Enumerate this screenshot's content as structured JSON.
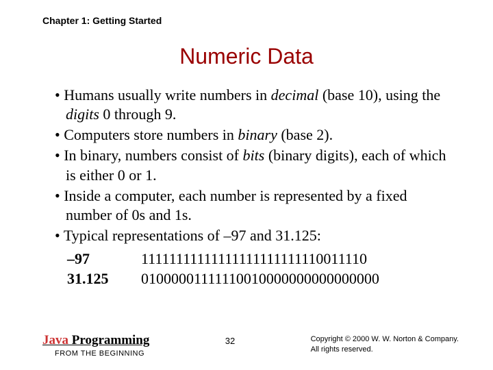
{
  "chapter": "Chapter 1: Getting Started",
  "title": "Numeric Data",
  "bullets": {
    "b0a": "Humans usually write numbers in ",
    "b0i1": "decimal",
    "b0b": " (base 10), using the ",
    "b0i2": "digits",
    "b0c": " 0 through 9.",
    "b1a": "Computers store numbers in ",
    "b1i1": "binary",
    "b1b": " (base 2).",
    "b2a": "In binary, numbers consist of ",
    "b2i1": "bits",
    "b2b": " (binary digits), each of which is either 0 or 1.",
    "b3": "Inside a computer, each number is represented by a fixed number of 0s and 1s.",
    "b4": "Typical representations of –97 and 31.125:"
  },
  "table": {
    "r0": {
      "label": "–97",
      "value": "11111111111111111111111110011110"
    },
    "r1": {
      "label": "31.125",
      "value": "01000001111110010000000000000000"
    }
  },
  "footer": {
    "brand_java": "Java",
    "brand_prog": " Programming",
    "brand_sub": "FROM THE BEGINNING",
    "page": "32",
    "copy1": "Copyright © 2000 W. W. Norton & Company.",
    "copy2": "All rights reserved."
  }
}
